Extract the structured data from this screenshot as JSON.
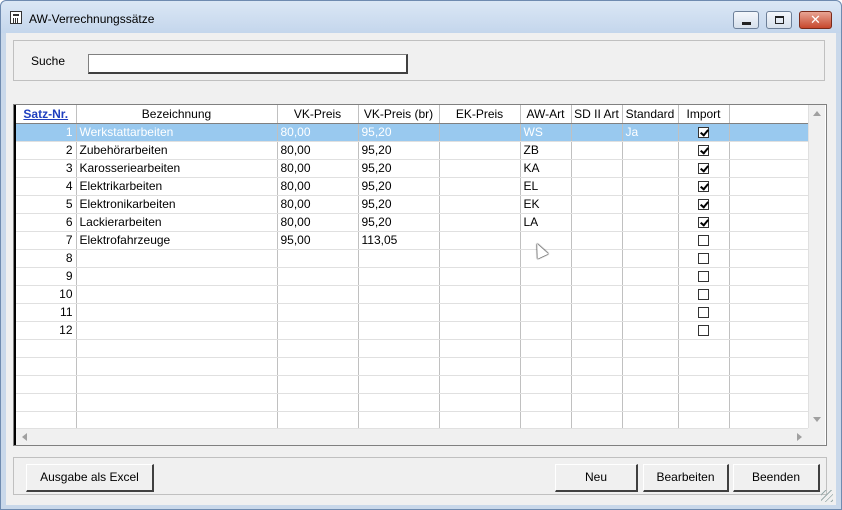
{
  "window": {
    "title": "AW-Verrechnungssätze"
  },
  "search": {
    "label": "Suche",
    "value": ""
  },
  "grid": {
    "columns": [
      "Satz-Nr.",
      "Bezeichnung",
      "VK-Preis",
      "VK-Preis (br)",
      "EK-Preis",
      "AW-Art",
      "SD II Art",
      "Standard",
      "Import"
    ],
    "rows": [
      {
        "nr": "1",
        "bezeichnung": "Werkstattarbeiten",
        "vk": "80,00",
        "vkbr": "95,20",
        "ek": "",
        "awart": "WS",
        "sd": "",
        "standard": "Ja",
        "import": true,
        "selected": true
      },
      {
        "nr": "2",
        "bezeichnung": "Zubehörarbeiten",
        "vk": "80,00",
        "vkbr": "95,20",
        "ek": "",
        "awart": "ZB",
        "sd": "",
        "standard": "",
        "import": true,
        "selected": false
      },
      {
        "nr": "3",
        "bezeichnung": "Karosseriearbeiten",
        "vk": "80,00",
        "vkbr": "95,20",
        "ek": "",
        "awart": "KA",
        "sd": "",
        "standard": "",
        "import": true,
        "selected": false
      },
      {
        "nr": "4",
        "bezeichnung": "Elektrikarbeiten",
        "vk": "80,00",
        "vkbr": "95,20",
        "ek": "",
        "awart": "EL",
        "sd": "",
        "standard": "",
        "import": true,
        "selected": false
      },
      {
        "nr": "5",
        "bezeichnung": "Elektronikarbeiten",
        "vk": "80,00",
        "vkbr": "95,20",
        "ek": "",
        "awart": "EK",
        "sd": "",
        "standard": "",
        "import": true,
        "selected": false
      },
      {
        "nr": "6",
        "bezeichnung": "Lackierarbeiten",
        "vk": "80,00",
        "vkbr": "95,20",
        "ek": "",
        "awart": "LA",
        "sd": "",
        "standard": "",
        "import": true,
        "selected": false
      },
      {
        "nr": "7",
        "bezeichnung": "Elektrofahrzeuge",
        "vk": "95,00",
        "vkbr": "113,05",
        "ek": "",
        "awart": "",
        "sd": "",
        "standard": "",
        "import": false,
        "selected": false
      },
      {
        "nr": "8",
        "bezeichnung": "",
        "vk": "",
        "vkbr": "",
        "ek": "",
        "awart": "",
        "sd": "",
        "standard": "",
        "import": false,
        "selected": false
      },
      {
        "nr": "9",
        "bezeichnung": "",
        "vk": "",
        "vkbr": "",
        "ek": "",
        "awart": "",
        "sd": "",
        "standard": "",
        "import": false,
        "selected": false
      },
      {
        "nr": "10",
        "bezeichnung": "",
        "vk": "",
        "vkbr": "",
        "ek": "",
        "awart": "",
        "sd": "",
        "standard": "",
        "import": false,
        "selected": false
      },
      {
        "nr": "11",
        "bezeichnung": "",
        "vk": "",
        "vkbr": "",
        "ek": "",
        "awart": "",
        "sd": "",
        "standard": "",
        "import": false,
        "selected": false
      },
      {
        "nr": "12",
        "bezeichnung": "",
        "vk": "",
        "vkbr": "",
        "ek": "",
        "awart": "",
        "sd": "",
        "standard": "",
        "import": false,
        "selected": false
      }
    ]
  },
  "buttons": {
    "excel": "Ausgabe als Excel",
    "neu": "Neu",
    "bearbeiten": "Bearbeiten",
    "beenden": "Beenden"
  },
  "colors": {
    "selection": "#99c9ef",
    "header_link": "#1f3fbf",
    "close_button": "#c7472d"
  }
}
